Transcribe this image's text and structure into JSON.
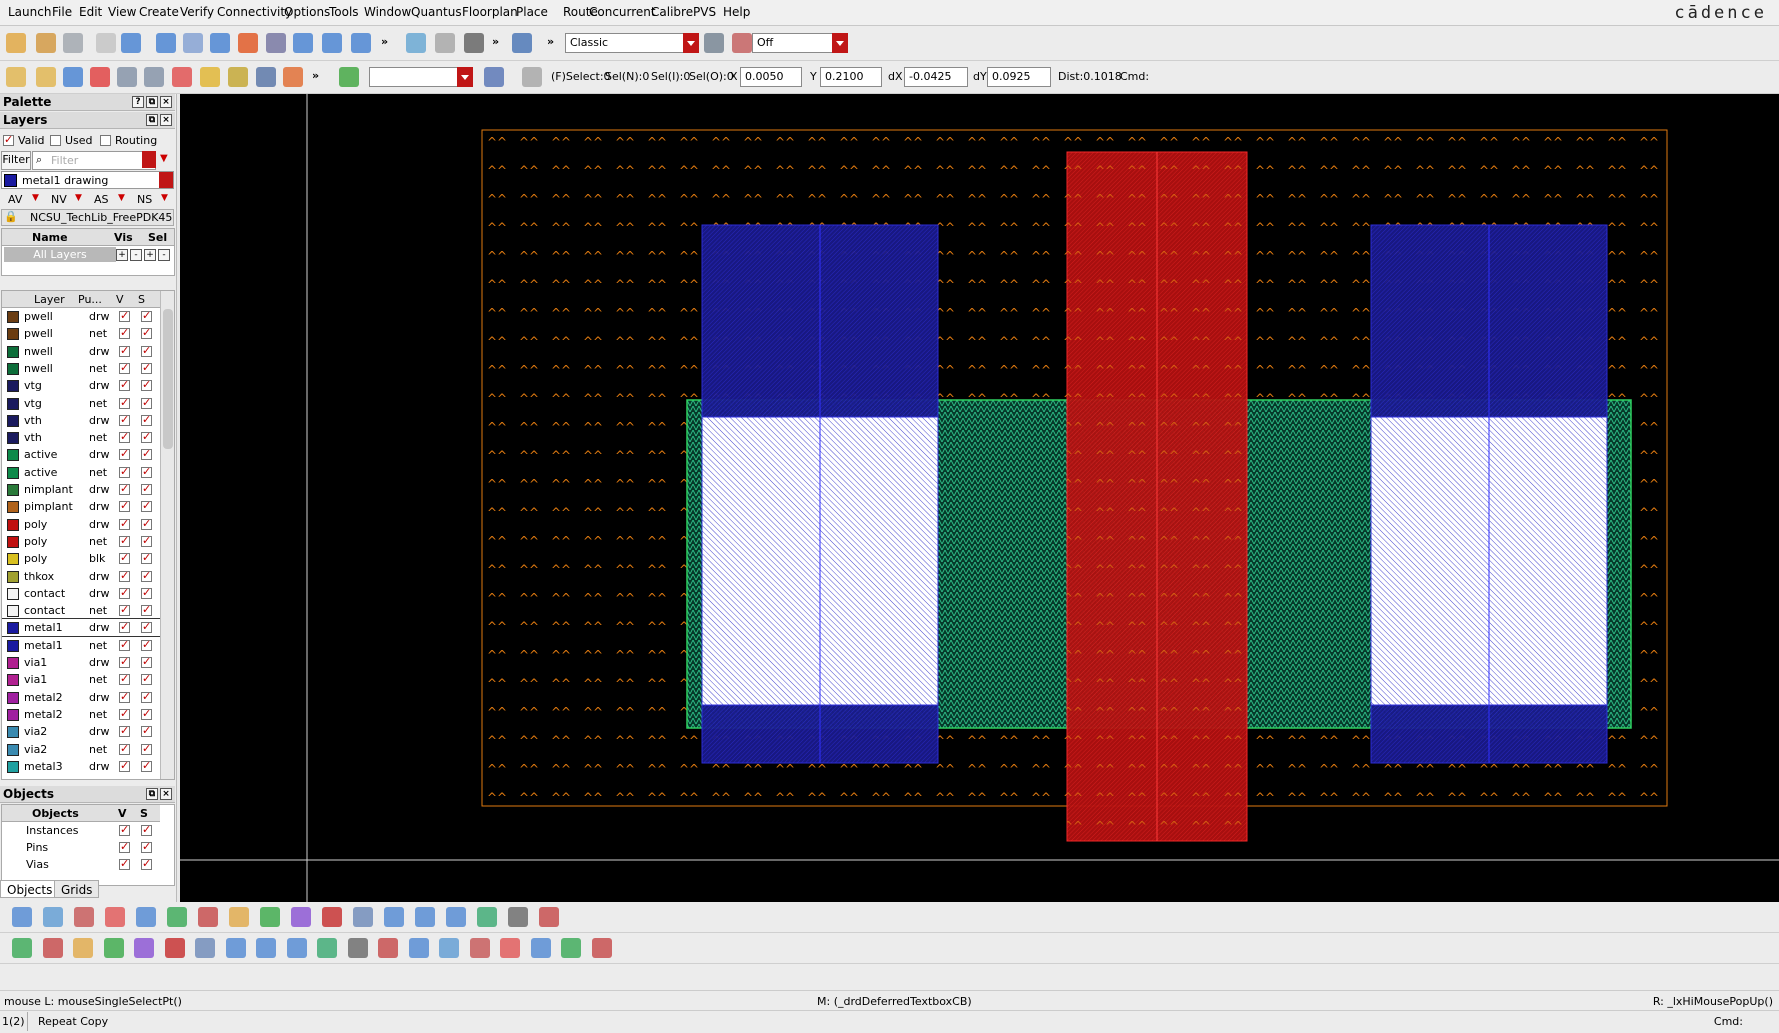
{
  "app": {
    "logo": "cādence"
  },
  "menu": [
    "Launch",
    "File",
    "Edit",
    "View",
    "Create",
    "Verify",
    "Connectivity",
    "Options",
    "Tools",
    "Window",
    "Quantus",
    "Floorplan",
    "Place",
    "Route",
    "Concurrent",
    "Calibre",
    "PVS",
    "Help"
  ],
  "toolbar1": {
    "workspace": "Classic",
    "mode": "Off"
  },
  "toolbar2": {
    "selection": {
      "f_select": "(F)Select:0",
      "sel_n": "Sel(N):0",
      "sel_i": "Sel(I):0",
      "sel_o": "Sel(O):0"
    },
    "x_label": "X",
    "x_value": "0.0050",
    "y_label": "Y",
    "y_value": "0.2100",
    "dx_label": "dX",
    "dx_value": "-0.0425",
    "dy_label": "dY",
    "dy_value": "0.0925",
    "dist": "Dist:0.1018",
    "cmd": "Cmd:"
  },
  "palette": {
    "title": "Palette",
    "layers_title": "Layers",
    "filters": [
      {
        "label": "Valid",
        "checked": true
      },
      {
        "label": "Used",
        "checked": false
      },
      {
        "label": "Routing",
        "checked": false
      }
    ],
    "filter_button": "Filter",
    "filter_placeholder": "Filter",
    "current_layer": "metal1 drawing",
    "current_layer_color": "#1a1aa0",
    "vis_toggles": [
      "AV",
      "NV",
      "AS",
      "NS"
    ],
    "techlib": "NCSU_TechLib_FreePDK45",
    "set_columns": [
      "Name",
      "Vis",
      "Sel"
    ],
    "all_layers": "All Layers",
    "set_buttons": [
      "+",
      "-",
      "+",
      "-"
    ],
    "layer_columns": [
      "Layer",
      "Pu...",
      "V",
      "S"
    ],
    "layers": [
      {
        "name": "pwell",
        "purpose": "drw",
        "color": "#6b3d12"
      },
      {
        "name": "pwell",
        "purpose": "net",
        "color": "#6b3d12"
      },
      {
        "name": "nwell",
        "purpose": "drw",
        "color": "#0d6e3a"
      },
      {
        "name": "nwell",
        "purpose": "net",
        "color": "#0d6e3a"
      },
      {
        "name": "vtg",
        "purpose": "drw",
        "color": "#1a1a5e"
      },
      {
        "name": "vtg",
        "purpose": "net",
        "color": "#1a1a5e"
      },
      {
        "name": "vth",
        "purpose": "drw",
        "color": "#1a1a5e"
      },
      {
        "name": "vth",
        "purpose": "net",
        "color": "#1a1a5e"
      },
      {
        "name": "active",
        "purpose": "drw",
        "color": "#0e8a4a"
      },
      {
        "name": "active",
        "purpose": "net",
        "color": "#0e8a4a"
      },
      {
        "name": "nimplant",
        "purpose": "drw",
        "color": "#2a7a3a"
      },
      {
        "name": "pimplant",
        "purpose": "drw",
        "color": "#b0621a"
      },
      {
        "name": "poly",
        "purpose": "drw",
        "color": "#c01010"
      },
      {
        "name": "poly",
        "purpose": "net",
        "color": "#c01010"
      },
      {
        "name": "poly",
        "purpose": "blk",
        "color": "#d8c020"
      },
      {
        "name": "thkox",
        "purpose": "drw",
        "color": "#a0a030"
      },
      {
        "name": "contact",
        "purpose": "drw",
        "color": "#f4f4f4"
      },
      {
        "name": "contact",
        "purpose": "net",
        "color": "#f4f4f4"
      },
      {
        "name": "metal1",
        "purpose": "drw",
        "color": "#1a1aa0"
      },
      {
        "name": "metal1",
        "purpose": "net",
        "color": "#1a1aa0"
      },
      {
        "name": "via1",
        "purpose": "drw",
        "color": "#b02090"
      },
      {
        "name": "via1",
        "purpose": "net",
        "color": "#b02090"
      },
      {
        "name": "metal2",
        "purpose": "drw",
        "color": "#a020a0"
      },
      {
        "name": "metal2",
        "purpose": "net",
        "color": "#a020a0"
      },
      {
        "name": "via2",
        "purpose": "drw",
        "color": "#3a8ab0"
      },
      {
        "name": "via2",
        "purpose": "net",
        "color": "#3a8ab0"
      },
      {
        "name": "metal3",
        "purpose": "drw",
        "color": "#20a0a0"
      }
    ],
    "selected_layer_index": 18,
    "objects_title": "Objects",
    "objects_columns": [
      "Objects",
      "V",
      "S"
    ],
    "objects": [
      "Instances",
      "Pins",
      "Vias"
    ],
    "tabs": [
      "Objects",
      "Grids"
    ]
  },
  "status": {
    "mouse_left": "mouse L: mouseSingleSelectPt()",
    "mouse_mid": "M: (_drdDeferredTextboxCB)",
    "mouse_right": "R: _lxHiMousePopUp()",
    "counter": "1(2)",
    "last_cmd": "Repeat Copy",
    "cmd": "Cmd:"
  }
}
